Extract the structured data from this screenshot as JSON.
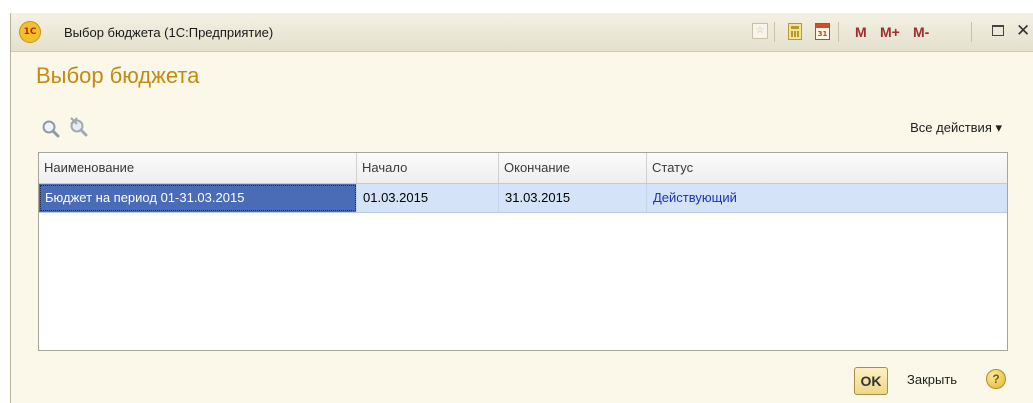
{
  "window": {
    "title": "Выбор бюджета  (1С:Предприятие)",
    "logo_text": "1C"
  },
  "titlebar_buttons": {
    "m_label": "M",
    "m_plus_label": "M+",
    "m_minus_label": "M-",
    "calendar_day": "31",
    "icons": [
      "favorites-icon",
      "calculator-icon",
      "calendar-icon",
      "maximize-icon",
      "close-icon"
    ]
  },
  "form": {
    "title": "Выбор бюджета",
    "all_actions": "Все действия ▾"
  },
  "table": {
    "columns": [
      "Наименование",
      "Начало",
      "Окончание",
      "Статус"
    ],
    "rows": [
      {
        "name": "Бюджет на период 01-31.03.2015",
        "start": "01.03.2015",
        "end": "31.03.2015",
        "status": "Действующий"
      }
    ]
  },
  "footer": {
    "ok_label": "OK",
    "close_label": "Закрыть",
    "help_label": "?"
  },
  "colors": {
    "window_bg": "#fbf8e9",
    "title_accent": "#c48a10",
    "selection": "#4a6bb5",
    "row_highlight": "#d4e3f7",
    "status_link": "#1b33b8"
  }
}
